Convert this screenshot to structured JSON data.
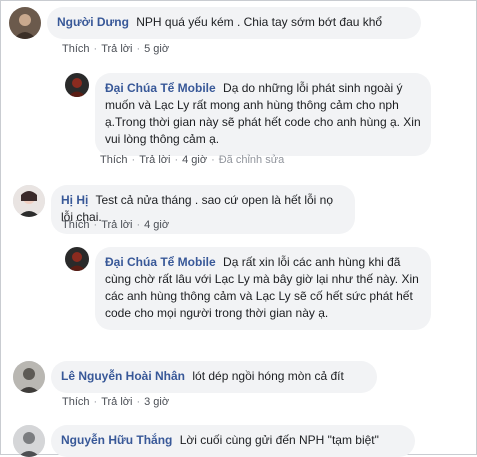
{
  "action_labels": {
    "like": "Thích",
    "reply": "Trả lời",
    "sep": "·"
  },
  "comments": [
    {
      "author": "Người Dưng",
      "text": "NPH quá yếu kém . Chia tay sớm bớt đau khổ",
      "time": "5 giờ",
      "edited": ""
    },
    {
      "author": "Đại Chúa Tể Mobile",
      "text": "Dạ do những lỗi phát sinh ngoài ý muốn và Lạc Ly rất mong anh hùng thông cảm cho nph ạ.Trong thời gian này sẽ phát hết code cho anh hùng ạ. Xin vui lòng thông cảm ạ.",
      "time": "4 giờ",
      "edited": "Đã chỉnh sửa"
    },
    {
      "author": "Hị Hị",
      "text": "Test cả nửa tháng . sao cứ open là hết lỗi nọ lỗi chai.",
      "time": "4 giờ",
      "edited": ""
    },
    {
      "author": "Đại Chúa Tể Mobile",
      "text": "Dạ rất xin lỗi các anh hùng khi đã cùng chờ rất lâu với Lạc Ly mà bây giờ lại như thế này. Xin các anh hùng thông cảm và Lạc Ly sẽ cố hết sức phát hết code cho mọi người trong thời gian này ạ.",
      "time": "",
      "edited": ""
    },
    {
      "author": "Lê Nguyễn Hoài Nhân",
      "text": "lót dép ngồi hóng mòn cả đít",
      "time": "3 giờ",
      "edited": ""
    },
    {
      "author": "Nguyễn Hữu Thắng",
      "text": "Lời cuối cùng gửi đến NPH \"tạm biệt\"",
      "time": "",
      "edited": ""
    }
  ]
}
